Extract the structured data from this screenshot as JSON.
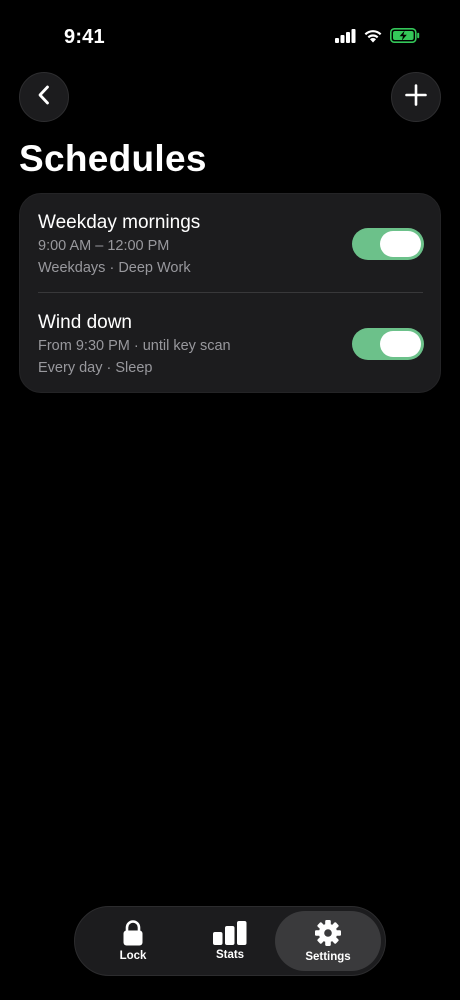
{
  "status_bar": {
    "time": "9:41",
    "icons": [
      "signal-icon",
      "wifi-icon",
      "battery-charging-icon"
    ],
    "battery_color": "#34c759"
  },
  "header": {
    "back_icon": "chevron-left-icon",
    "add_icon": "plus-icon",
    "title": "Schedules"
  },
  "schedules": [
    {
      "title": "Weekday mornings",
      "time": "9:00 AM – 12:00 PM",
      "meta": "Weekdays · Deep Work",
      "enabled": true
    },
    {
      "title": "Wind down",
      "time": "From 9:30 PM · until key scan",
      "meta": "Every day · Sleep",
      "enabled": true
    }
  ],
  "tab_bar": {
    "tabs": [
      {
        "label": "Lock",
        "icon": "lock-icon",
        "selected": false
      },
      {
        "label": "Stats",
        "icon": "bar-chart-icon",
        "selected": false
      },
      {
        "label": "Settings",
        "icon": "gear-icon",
        "selected": true
      }
    ]
  },
  "colors": {
    "background": "#000000",
    "card": "#1c1c1e",
    "toggle_on": "#6cc18a",
    "secondary_text": "#98989d"
  }
}
